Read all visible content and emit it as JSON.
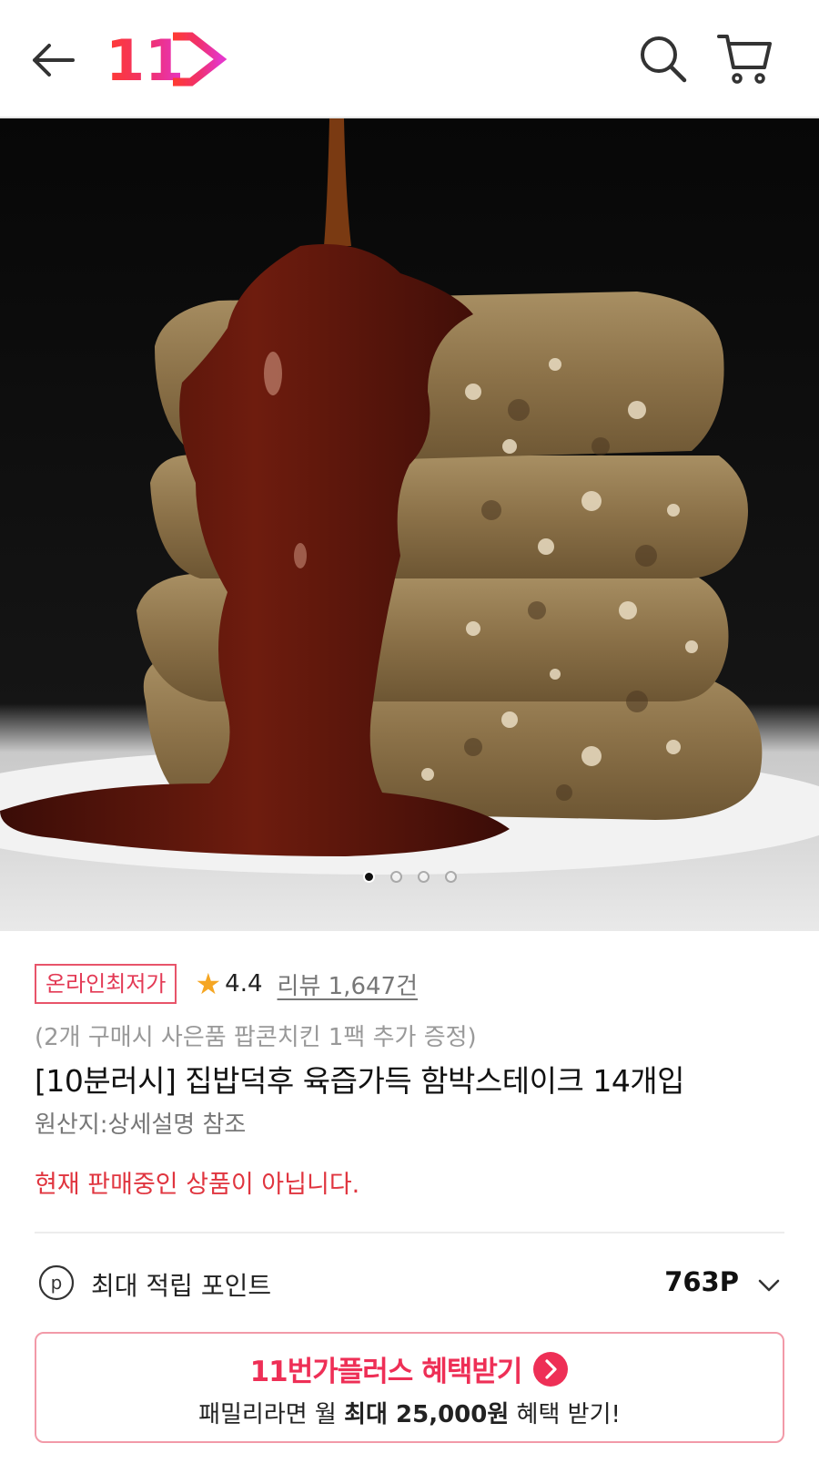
{
  "header": {
    "back_icon": "arrow-left-icon",
    "logo_text": "11",
    "search_icon": "search-icon",
    "cart_icon": "cart-icon",
    "brand_color": "#ee2f56"
  },
  "gallery": {
    "image_alt": "hamburger-steak-stack-with-sauce",
    "total_slides": 4,
    "active_slide": 1
  },
  "product": {
    "badge": "온라인최저가",
    "rating": "4.4",
    "review_label": "리뷰 1,647건",
    "promo": "(2개 구매시 사은품 팝콘치킨 1팩 추가 증정)",
    "title": "[10분러시] 집밥덕후 육즙가득 함박스테이크 14개입",
    "origin": "원산지:상세설명 참조",
    "status": "현재 판매중인 상품이 아닙니다."
  },
  "points": {
    "icon": "p",
    "label": "최대 적립 포인트",
    "value": "763P"
  },
  "plus_banner": {
    "brand": "11번가플러스",
    "action": "혜택받기",
    "desc_prefix": "패밀리라면 월 ",
    "desc_bold": "최대 25,000원",
    "desc_suffix": " 혜택 받기!"
  }
}
